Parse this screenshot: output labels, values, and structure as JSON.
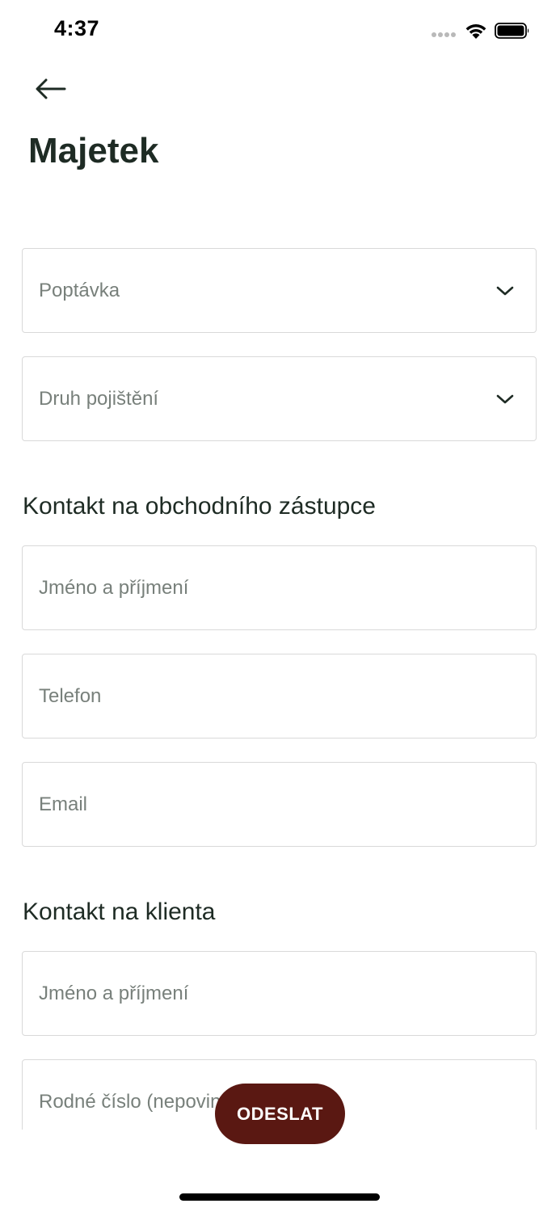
{
  "status_bar": {
    "time": "4:37"
  },
  "header": {
    "back_icon": "arrow-left-icon",
    "title": "Majetek"
  },
  "form": {
    "inquiry_select": {
      "placeholder": "Poptávka",
      "icon": "chevron-down-icon"
    },
    "insurance_type_select": {
      "placeholder": "Druh pojištění",
      "icon": "chevron-down-icon"
    },
    "sales_rep_section": {
      "heading": "Kontakt na obchodního zástupce",
      "name_placeholder": "Jméno a příjmení",
      "phone_placeholder": "Telefon",
      "email_placeholder": "Email"
    },
    "client_section": {
      "heading": "Kontakt na klienta",
      "name_placeholder": "Jméno a příjmení",
      "birth_number_placeholder": "Rodné číslo (nepovinné)"
    },
    "submit_label": "ODESLAT"
  },
  "colors": {
    "accent": "#5a1812",
    "title_text": "#1e2b24",
    "placeholder_text": "#78807b",
    "field_border": "#d9d9d9"
  }
}
